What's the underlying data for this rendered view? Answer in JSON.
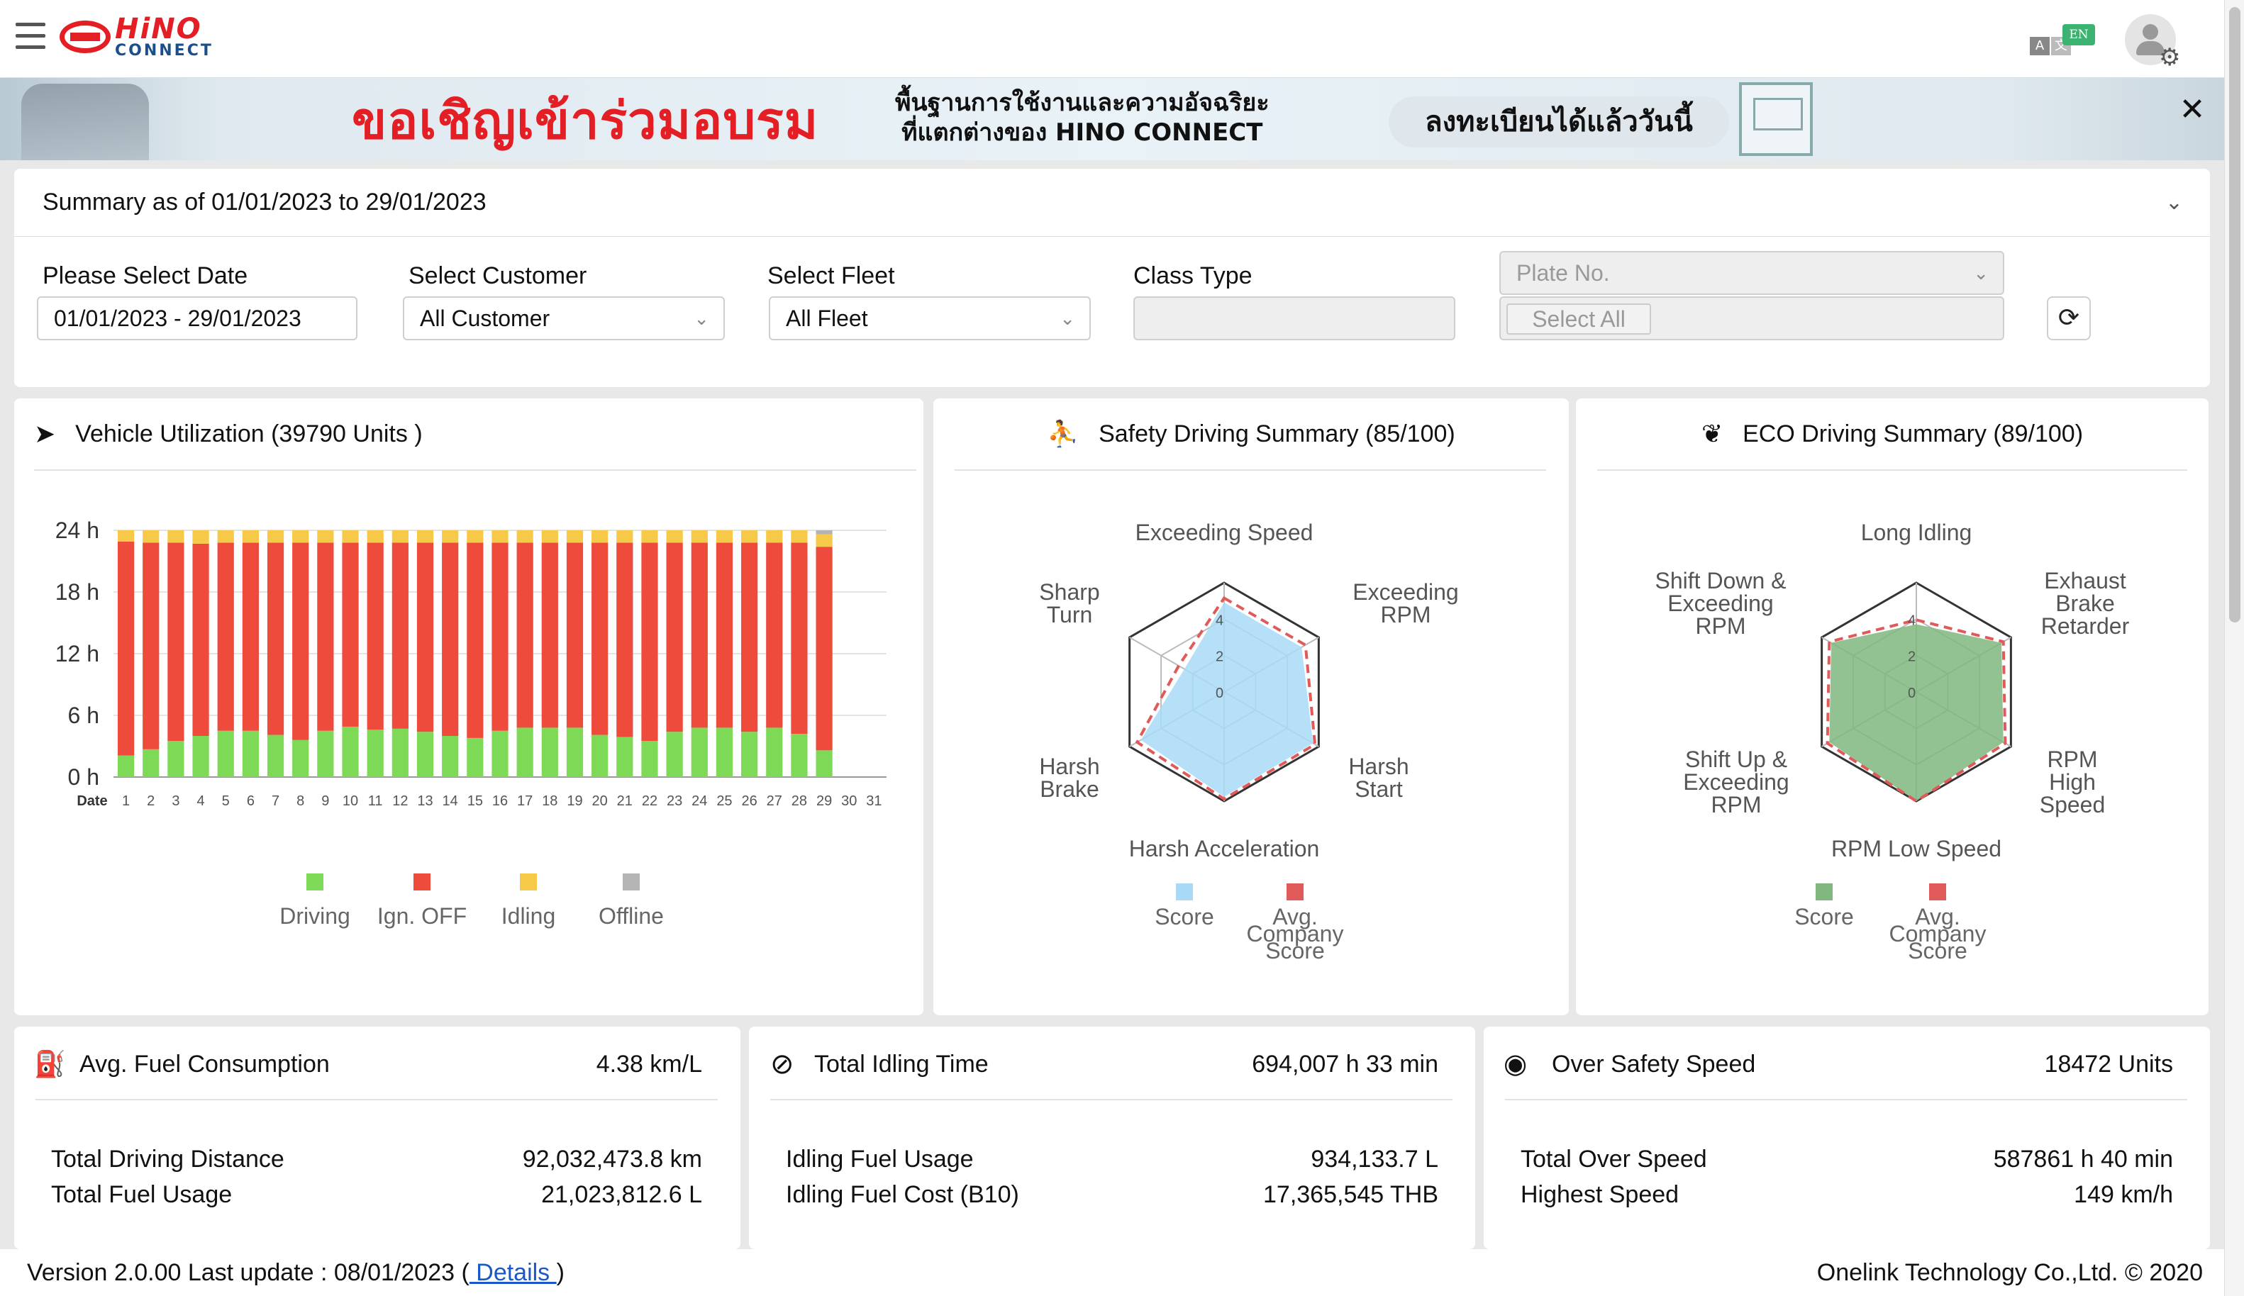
{
  "header": {
    "logo_top": "HiNO",
    "logo_bottom": "CONNECT",
    "lang_a": "A",
    "lang_b": "文",
    "lang_badge": "EN"
  },
  "banner": {
    "main_text": "ขอเชิญเข้าร่วมอบรม",
    "sub_line1": "พื้นฐานการใช้งานและความอัจฉริยะ",
    "sub_line2": "ที่แตกต่างของ HINO CONNECT",
    "register_text": "ลงทะเบียนได้แล้ววันนี้",
    "close_glyph": "✕"
  },
  "filters": {
    "summary_title": "Summary as of 01/01/2023 to 29/01/2023",
    "date_label": "Please Select Date",
    "date_value": "01/01/2023 - 29/01/2023",
    "customer_label": "Select Customer",
    "customer_value": "All Customer",
    "fleet_label": "Select Fleet",
    "fleet_value": "All Fleet",
    "class_label": "Class Type",
    "class_value": "",
    "plate_placeholder": "Plate No.",
    "select_all": "Select All",
    "refresh_glyph": "⟳",
    "caret_glyph": "⌄"
  },
  "utilization": {
    "title": "Vehicle Utilization (39790 Units )",
    "icon_glyph": "➤"
  },
  "safety": {
    "title": "Safety Driving Summary (85/100)",
    "icon_glyph": "⛹"
  },
  "eco": {
    "title": "ECO Driving Summary (89/100)",
    "icon_glyph": "❦"
  },
  "chart_data": [
    {
      "type": "bar",
      "stacked": true,
      "title": "Vehicle Utilization (39790 Units )",
      "xlabel": "Date",
      "ylabel": "",
      "ylim": [
        0,
        24
      ],
      "yticks": [
        "0 h",
        "6 h",
        "12 h",
        "18 h",
        "24 h"
      ],
      "categories": [
        "1",
        "2",
        "3",
        "4",
        "5",
        "6",
        "7",
        "8",
        "9",
        "10",
        "11",
        "12",
        "13",
        "14",
        "15",
        "16",
        "17",
        "18",
        "19",
        "20",
        "21",
        "22",
        "23",
        "24",
        "25",
        "26",
        "27",
        "28",
        "29",
        "30",
        "31"
      ],
      "series": [
        {
          "name": "Driving",
          "color": "#7ed957",
          "values": [
            2.1,
            2.7,
            3.5,
            4.0,
            4.5,
            4.5,
            4.1,
            3.6,
            4.5,
            4.9,
            4.6,
            4.7,
            4.4,
            4.0,
            3.8,
            4.5,
            4.8,
            4.8,
            4.8,
            4.1,
            3.9,
            3.5,
            4.4,
            4.8,
            4.8,
            4.4,
            4.8,
            4.2,
            2.6,
            0,
            0
          ]
        },
        {
          "name": "Ign. OFF",
          "color": "#ee4b3d",
          "values": [
            20.8,
            20.1,
            19.3,
            18.7,
            18.3,
            18.3,
            18.7,
            19.2,
            18.3,
            17.9,
            18.2,
            18.1,
            18.4,
            18.8,
            19.0,
            18.3,
            18.0,
            18.0,
            18.0,
            18.7,
            18.9,
            19.3,
            18.4,
            18.0,
            18.0,
            18.4,
            18.0,
            18.6,
            19.8,
            0,
            0
          ]
        },
        {
          "name": "Idling",
          "color": "#f7c948",
          "values": [
            1.1,
            1.2,
            1.2,
            1.3,
            1.2,
            1.2,
            1.2,
            1.2,
            1.2,
            1.2,
            1.2,
            1.2,
            1.2,
            1.2,
            1.2,
            1.2,
            1.2,
            1.2,
            1.2,
            1.2,
            1.2,
            1.2,
            1.2,
            1.2,
            1.2,
            1.2,
            1.2,
            1.2,
            1.2,
            0,
            0
          ]
        },
        {
          "name": "Offline",
          "color": "#b4b4b4",
          "values": [
            0,
            0,
            0,
            0,
            0,
            0,
            0,
            0,
            0,
            0,
            0,
            0,
            0,
            0,
            0,
            0,
            0,
            0,
            0,
            0,
            0,
            0,
            0,
            0,
            0,
            0,
            0,
            0,
            0.4,
            0,
            0
          ]
        }
      ],
      "legend": "bottom"
    },
    {
      "type": "radar",
      "title": "Safety Driving Summary (85/100)",
      "axes": [
        "Exceeding Speed",
        "Exceeding RPM",
        "Harsh Start",
        "Harsh Acceleration",
        "Harsh Brake",
        "Sharp Turn"
      ],
      "ticks": [
        "0",
        "2",
        "4"
      ],
      "rlim": [
        0,
        5
      ],
      "series": [
        {
          "name": "Score",
          "color": "#a8daf7",
          "values": [
            4.1,
            4.1,
            4.7,
            4.8,
            4.4,
            2.1
          ]
        },
        {
          "name": "Avg. Company Score",
          "color": "#e05a5a",
          "values": [
            4.3,
            4.3,
            4.8,
            4.9,
            4.6,
            2.4
          ]
        }
      ],
      "legend": "bottom"
    },
    {
      "type": "radar",
      "title": "ECO Driving Summary (89/100)",
      "axes": [
        "Long Idling",
        "Exhaust Brake Retarder",
        "RPM High Speed",
        "RPM Low Speed",
        "Shift Up & Exceeding RPM",
        "Shift Down & Exceeding RPM"
      ],
      "ticks": [
        "0",
        "2",
        "4"
      ],
      "rlim": [
        0,
        5
      ],
      "series": [
        {
          "name": "Score",
          "color": "#7fb77e",
          "values": [
            3.1,
            4.5,
            4.6,
            5.0,
            4.6,
            4.5
          ]
        },
        {
          "name": "Avg. Company Score",
          "color": "#e05a5a",
          "values": [
            3.3,
            4.6,
            4.7,
            5.0,
            4.7,
            4.6
          ]
        }
      ],
      "legend": "bottom"
    }
  ],
  "fuel": {
    "title": "Avg. Fuel Consumption",
    "value": "4.38 km/L",
    "icon_glyph": "⛽",
    "row1_label": "Total Driving Distance",
    "row1_value": "92,032,473.8 km",
    "row2_label": "Total Fuel Usage",
    "row2_value": "21,023,812.6 L"
  },
  "idling": {
    "title": "Total Idling Time",
    "value": "694,007 h 33 min",
    "icon_glyph": "⊘",
    "row1_label": "Idling Fuel Usage",
    "row1_value": "934,133.7 L",
    "row2_label": "Idling Fuel Cost (B10)",
    "row2_value": "17,365,545 THB"
  },
  "overspeed": {
    "title": "Over Safety Speed",
    "value": "18472 Units",
    "icon_glyph": "◉",
    "row1_label": "Total Over Speed",
    "row1_value": "587861 h 40 min",
    "row2_label": "Highest Speed",
    "row2_value": "149 km/h"
  },
  "footer": {
    "version_text": "Version 2.0.00 Last update : 08/01/2023 (",
    "details_link": " Details ",
    "version_close": ")",
    "copyright": "Onelink Technology Co.,Ltd. © 2020"
  }
}
